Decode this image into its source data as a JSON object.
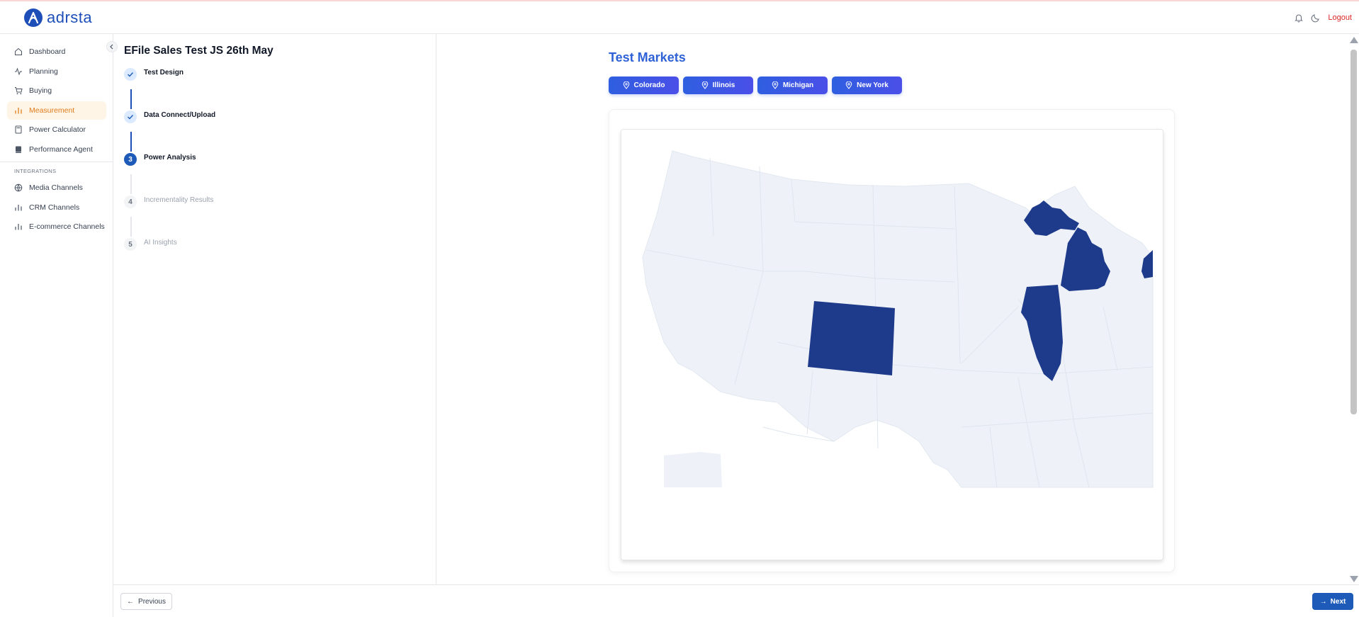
{
  "header": {
    "brand": "adrsta",
    "logout_label": "Logout",
    "icons": [
      "bell-icon",
      "moon-icon"
    ]
  },
  "sidebar": {
    "items": [
      {
        "label": "Dashboard",
        "icon": "home-icon"
      },
      {
        "label": "Planning",
        "icon": "activity-icon"
      },
      {
        "label": "Buying",
        "icon": "cart-icon"
      },
      {
        "label": "Measurement",
        "icon": "bar-chart-icon",
        "active": true
      },
      {
        "label": "Power Calculator",
        "icon": "calculator-icon"
      },
      {
        "label": "Performance Agent",
        "icon": "agent-icon"
      }
    ],
    "section_label": "INTEGRATIONS",
    "integrations": [
      {
        "label": "Media Channels",
        "icon": "globe-icon"
      },
      {
        "label": "CRM Channels",
        "icon": "bar-chart-icon"
      },
      {
        "label": "E-commerce Channels",
        "icon": "bar-chart-icon"
      }
    ]
  },
  "stepper": {
    "title": "EFile Sales Test JS 26th May",
    "steps": [
      {
        "number": "",
        "label": "Test Design",
        "status": "done"
      },
      {
        "number": "",
        "label": "Data Connect/Upload",
        "status": "done"
      },
      {
        "number": "3",
        "label": "Power Analysis",
        "status": "current"
      },
      {
        "number": "4",
        "label": "Incrementality Results",
        "status": "pending"
      },
      {
        "number": "5",
        "label": "AI Insights",
        "status": "pending"
      }
    ]
  },
  "main": {
    "title": "Test Markets",
    "markets": [
      "Colorado",
      "Illinois",
      "Michigan",
      "New York"
    ],
    "map": {
      "base_color": "#eef2f8",
      "highlight_color": "#1e3a8a",
      "highlighted_states": [
        "Colorado",
        "Illinois",
        "Michigan",
        "New York"
      ]
    }
  },
  "footer": {
    "previous_label": "Previous",
    "next_label": "Next"
  },
  "colors": {
    "accent": "#1e5bb8",
    "active_nav_bg": "#fff5e6",
    "active_nav_text": "#e07b1a",
    "chip_gradient_start": "#2f5fe0",
    "chip_gradient_end": "#4a4fe8",
    "logout": "#dc2626"
  }
}
